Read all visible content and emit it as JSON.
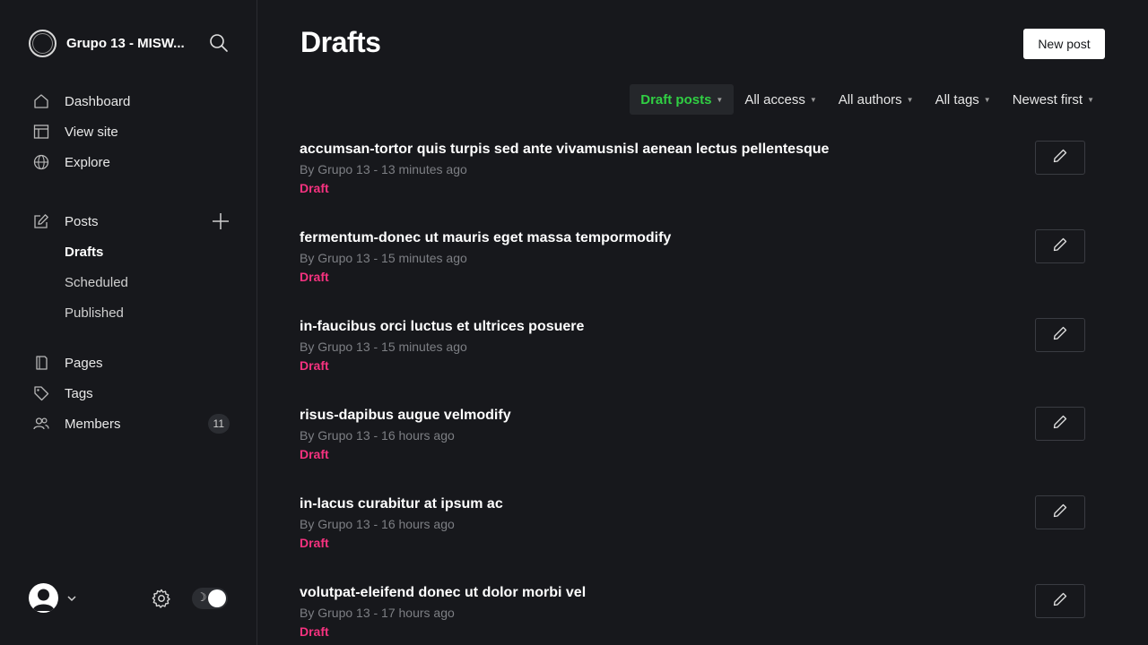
{
  "sidebar": {
    "site_name": "Grupo 13 - MISW...",
    "nav": [
      {
        "label": "Dashboard",
        "icon": "home-icon"
      },
      {
        "label": "View site",
        "icon": "layout-icon"
      },
      {
        "label": "Explore",
        "icon": "globe-icon"
      }
    ],
    "posts_label": "Posts",
    "posts_sub": [
      "Drafts",
      "Scheduled",
      "Published"
    ],
    "more": [
      {
        "label": "Pages",
        "icon": "pages-icon"
      },
      {
        "label": "Tags",
        "icon": "tag-icon"
      },
      {
        "label": "Members",
        "icon": "members-icon",
        "badge": "11"
      }
    ]
  },
  "header": {
    "title": "Drafts",
    "new_post_label": "New post"
  },
  "filters": [
    {
      "label": "Draft posts",
      "active": true
    },
    {
      "label": "All access",
      "active": false
    },
    {
      "label": "All authors",
      "active": false
    },
    {
      "label": "All tags",
      "active": false
    },
    {
      "label": "Newest first",
      "active": false
    }
  ],
  "posts": [
    {
      "title": "accumsan-tortor quis turpis sed ante vivamusnisl aenean lectus pellentesque",
      "meta": "By Grupo 13 - 13 minutes ago",
      "status": "Draft"
    },
    {
      "title": "fermentum-donec ut mauris eget massa tempormodify",
      "meta": "By Grupo 13 - 15 minutes ago",
      "status": "Draft"
    },
    {
      "title": "in-faucibus orci luctus et ultrices posuere",
      "meta": "By Grupo 13 - 15 minutes ago",
      "status": "Draft"
    },
    {
      "title": "risus-dapibus augue velmodify",
      "meta": "By Grupo 13 - 16 hours ago",
      "status": "Draft"
    },
    {
      "title": "in-lacus curabitur at ipsum ac",
      "meta": "By Grupo 13 - 16 hours ago",
      "status": "Draft"
    },
    {
      "title": "volutpat-eleifend donec ut dolor morbi vel",
      "meta": "By Grupo 13 - 17 hours ago",
      "status": "Draft"
    }
  ],
  "colors": {
    "background": "#17181c",
    "accent_green": "#30cf43",
    "draft_pink": "#f5327f"
  }
}
